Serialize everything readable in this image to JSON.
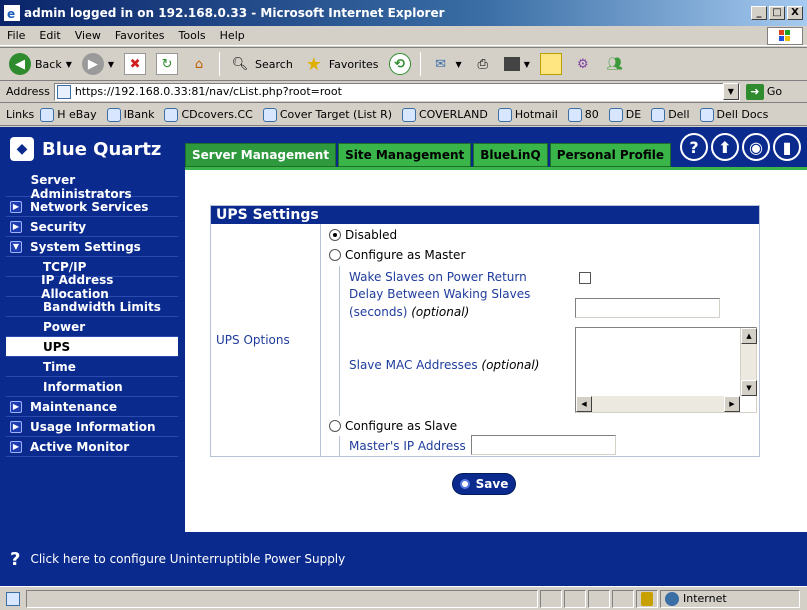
{
  "window": {
    "title": "admin logged in on 192.168.0.33 - Microsoft Internet Explorer",
    "min_label": "_",
    "max_label": "□",
    "close_label": "X"
  },
  "menu": [
    "File",
    "Edit",
    "View",
    "Favorites",
    "Tools",
    "Help"
  ],
  "toolbar": {
    "back_label": "Back",
    "search_label": "Search",
    "favorites_label": "Favorites"
  },
  "address": {
    "label": "Address",
    "url": "https://192.168.0.33:81/nav/cList.php?root=root",
    "go_label": "Go"
  },
  "links": {
    "label": "Links",
    "items": [
      "H eBay",
      "IBank",
      "CDcovers.CC",
      "Cover Target (List R)",
      "COVERLAND",
      "Hotmail",
      "80",
      "DE",
      "Dell",
      "Dell Docs"
    ]
  },
  "app": {
    "logo_text": "Blue Quartz",
    "tabs": [
      "Server Management",
      "Site Management",
      "BlueLinQ",
      "Personal Profile"
    ],
    "active_tab": "Server Management"
  },
  "sidebar": {
    "items": [
      {
        "label": "Server Administrators",
        "level": 0,
        "icon": "none"
      },
      {
        "label": "Network Services",
        "level": 0,
        "icon": "expand"
      },
      {
        "label": "Security",
        "level": 0,
        "icon": "expand"
      },
      {
        "label": "System Settings",
        "level": 0,
        "icon": "collapse"
      },
      {
        "label": "TCP/IP",
        "level": 1
      },
      {
        "label": "IP Address Allocation",
        "level": 1
      },
      {
        "label": "Bandwidth Limits",
        "level": 1
      },
      {
        "label": "Power",
        "level": 1
      },
      {
        "label": "UPS",
        "level": 1,
        "active": true
      },
      {
        "label": "Time",
        "level": 1
      },
      {
        "label": "Information",
        "level": 1
      },
      {
        "label": "Maintenance",
        "level": 0,
        "icon": "expand"
      },
      {
        "label": "Usage Information",
        "level": 0,
        "icon": "expand"
      },
      {
        "label": "Active Monitor",
        "level": 0,
        "icon": "expand"
      }
    ]
  },
  "ups": {
    "title": "UPS Settings",
    "options_label": "UPS Options",
    "radio_disabled": "Disabled",
    "radio_master": "Configure as Master",
    "wake_slaves_label": "Wake Slaves on Power Return",
    "delay_label_line1": "Delay Between Waking Slaves",
    "delay_label_line2": "(seconds)",
    "optional": "(optional)",
    "slave_mac_label": "Slave MAC Addresses",
    "radio_slave": "Configure as Slave",
    "master_ip_label": "Master's IP Address",
    "selected": "Disabled"
  },
  "save_label": "Save",
  "footer_help": "Click here to configure Uninterruptible Power Supply",
  "status": {
    "zone": "Internet"
  },
  "colors": {
    "brand_blue": "#0a2a8e",
    "tab_green": "#39b54a"
  }
}
